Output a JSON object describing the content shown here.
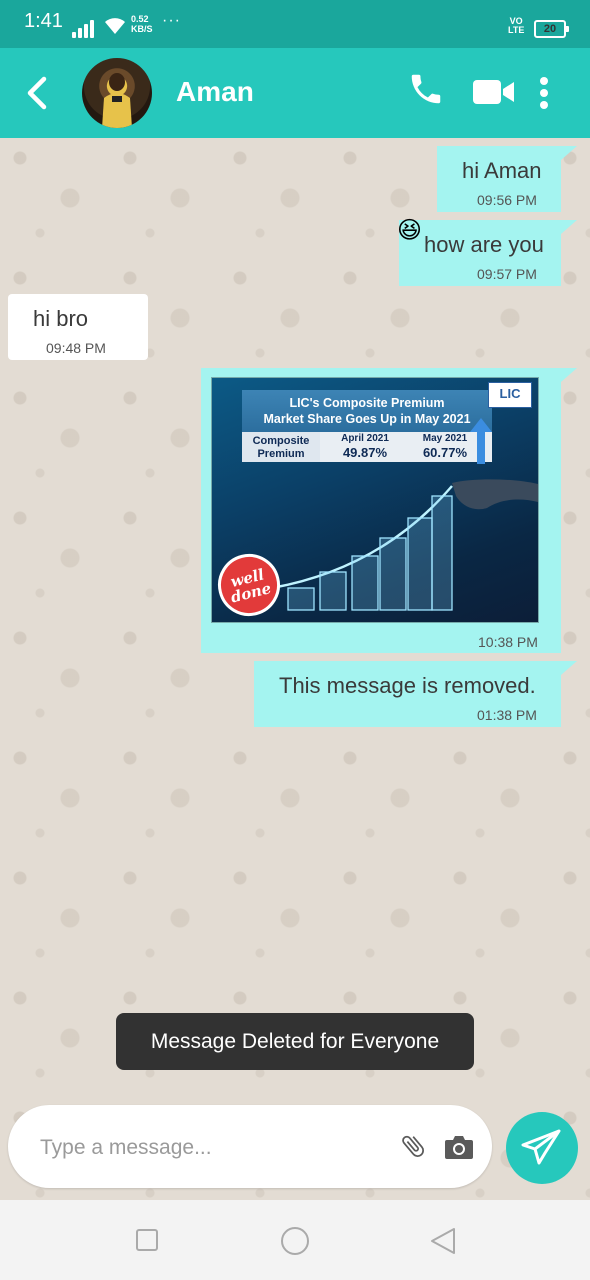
{
  "status_bar": {
    "time": "1:41",
    "net_speed_value": "0.52",
    "net_speed_unit": "KB/S",
    "more": "···",
    "volte_line1": "VO",
    "volte_line2": "LTE",
    "battery": "20"
  },
  "header": {
    "contact_name": "Aman",
    "accent_color": "#26c8bc",
    "icons": [
      "back-arrow-icon",
      "avatar",
      "phone-icon",
      "video-call-icon",
      "more-vert-icon"
    ]
  },
  "messages": [
    {
      "direction": "outgoing",
      "text": "hi Aman",
      "time": "09:56 PM"
    },
    {
      "direction": "outgoing",
      "text": "how are you",
      "time": "09:57 PM",
      "emoji": "😆"
    },
    {
      "direction": "incoming",
      "text": "hi bro",
      "time": "09:48 PM"
    },
    {
      "direction": "outgoing",
      "type": "image",
      "time": "10:38 PM",
      "image": {
        "title_line1": "LIC's Composite Premium",
        "title_line2": "Market Share Goes Up in May 2021",
        "row_label_line1": "Composite",
        "row_label_line2": "Premium",
        "col1_header": "April 2021",
        "col1_value": "49.87%",
        "col2_header": "May 2021",
        "col2_value": "60.77%",
        "logo_text": "LIC",
        "badge_line1": "well",
        "badge_line2": "done"
      }
    },
    {
      "direction": "outgoing",
      "text": "This message is removed.",
      "time": "01:38 PM"
    }
  ],
  "toast": "Message Deleted for Everyone",
  "composer": {
    "placeholder": "Type a message...",
    "icons": [
      "attach-icon",
      "camera-icon",
      "send-icon"
    ]
  },
  "nav_bar": {
    "icons": [
      "recents-square-icon",
      "home-circle-icon",
      "back-triangle-icon"
    ]
  }
}
